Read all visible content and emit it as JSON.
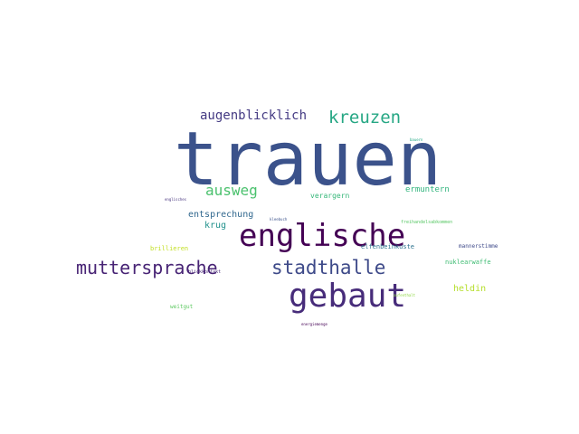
{
  "words": [
    {
      "text": "trauen",
      "color": "#3b528b"
    },
    {
      "text": "englische",
      "color": "#440154"
    },
    {
      "text": "gebaut",
      "color": "#472c7a"
    },
    {
      "text": "muttersprache",
      "color": "#482475"
    },
    {
      "text": "stadthalle",
      "color": "#3e4a89"
    },
    {
      "text": "kreuzen",
      "color": "#26a784"
    },
    {
      "text": "augenblicklich",
      "color": "#443a83"
    },
    {
      "text": "ausweg",
      "color": "#4ac16d"
    },
    {
      "text": "entsprechung",
      "color": "#31688e"
    },
    {
      "text": "krug",
      "color": "#21918c"
    },
    {
      "text": "ermuntern",
      "color": "#2fb47c"
    },
    {
      "text": "verargern",
      "color": "#35b779"
    },
    {
      "text": "heldin",
      "color": "#b5de2b"
    },
    {
      "text": "elfenbeinkuste",
      "color": "#2c728e"
    },
    {
      "text": "nuklearwaffe",
      "color": "#3fbc73"
    },
    {
      "text": "mannerstimme",
      "color": "#3e4989"
    },
    {
      "text": "brillieren",
      "color": "#c2df23"
    },
    {
      "text": "weitgut",
      "color": "#5ec962"
    },
    {
      "text": "englisches",
      "color": "#46337e"
    },
    {
      "text": "kleebuch",
      "color": "#3b528b"
    },
    {
      "text": "blickkontakt",
      "color": "#482878"
    },
    {
      "text": "bauern",
      "color": "#22a884"
    },
    {
      "text": "freihandelsabkommen",
      "color": "#58c765"
    },
    {
      "text": "aufenthalt",
      "color": "#8fd744"
    },
    {
      "text": "energiemenge",
      "color": "#440154"
    }
  ]
}
